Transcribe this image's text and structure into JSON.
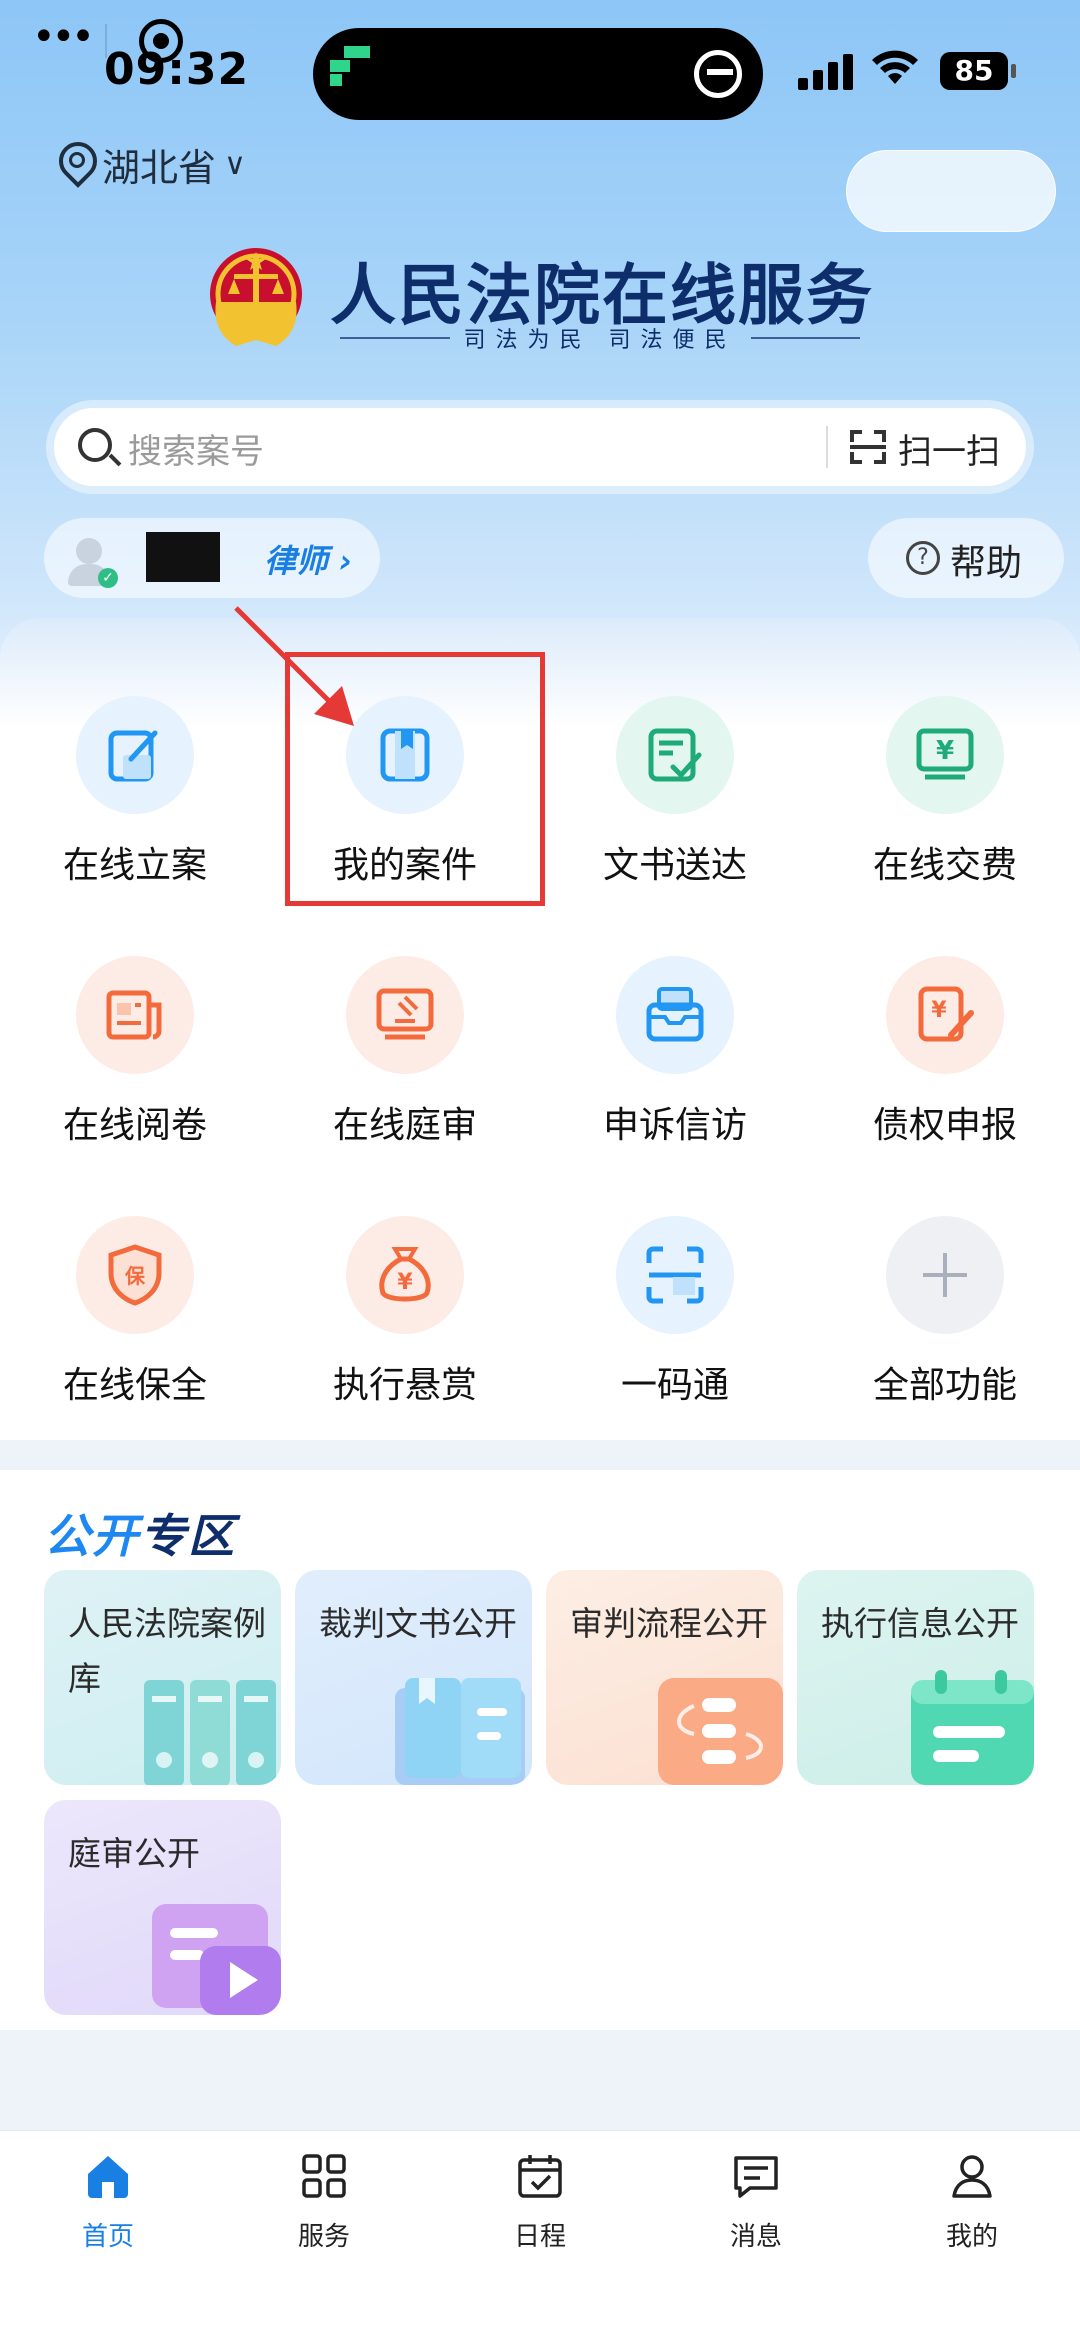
{
  "status_bar": {
    "time": "09:32",
    "battery": "85"
  },
  "header": {
    "location": "湖北省",
    "title": "人民法院在线服务",
    "slogan": "司法为民  司法便民"
  },
  "search": {
    "placeholder": "搜索案号",
    "scan_label": "扫一扫"
  },
  "user": {
    "role_label": "律师",
    "help_label": "帮助"
  },
  "services": [
    {
      "label": "在线立案",
      "icon": "edit-icon"
    },
    {
      "label": "我的案件",
      "icon": "book-icon"
    },
    {
      "label": "文书送达",
      "icon": "document-check-icon"
    },
    {
      "label": "在线交费",
      "icon": "monitor-yen-icon"
    },
    {
      "label": "在线阅卷",
      "icon": "newspaper-icon"
    },
    {
      "label": "在线庭审",
      "icon": "gavel-screen-icon"
    },
    {
      "label": "申诉信访",
      "icon": "mailbox-icon"
    },
    {
      "label": "债权申报",
      "icon": "yen-edit-icon"
    },
    {
      "label": "在线保全",
      "icon": "shield-icon"
    },
    {
      "label": "执行悬赏",
      "icon": "money-bag-icon"
    },
    {
      "label": "一码通",
      "icon": "scan-frame-icon"
    },
    {
      "label": "全部功能",
      "icon": "plus-icon"
    }
  ],
  "public_zone": {
    "title_part1": "公开",
    "title_part2": "专区",
    "cards": [
      {
        "label": "人民法院案例库"
      },
      {
        "label": "裁判文书公开"
      },
      {
        "label": "审判流程公开"
      },
      {
        "label": "执行信息公开"
      },
      {
        "label": "庭审公开"
      }
    ]
  },
  "tabbar": [
    {
      "label": "首页",
      "icon": "home-icon",
      "active": true
    },
    {
      "label": "服务",
      "icon": "grid-icon",
      "active": false
    },
    {
      "label": "日程",
      "icon": "calendar-icon",
      "active": false
    },
    {
      "label": "消息",
      "icon": "message-icon",
      "active": false
    },
    {
      "label": "我的",
      "icon": "profile-icon",
      "active": false
    }
  ],
  "colors": {
    "accent": "#1a7fe3",
    "highlight": "#e53935",
    "title": "#0d2e6b"
  }
}
